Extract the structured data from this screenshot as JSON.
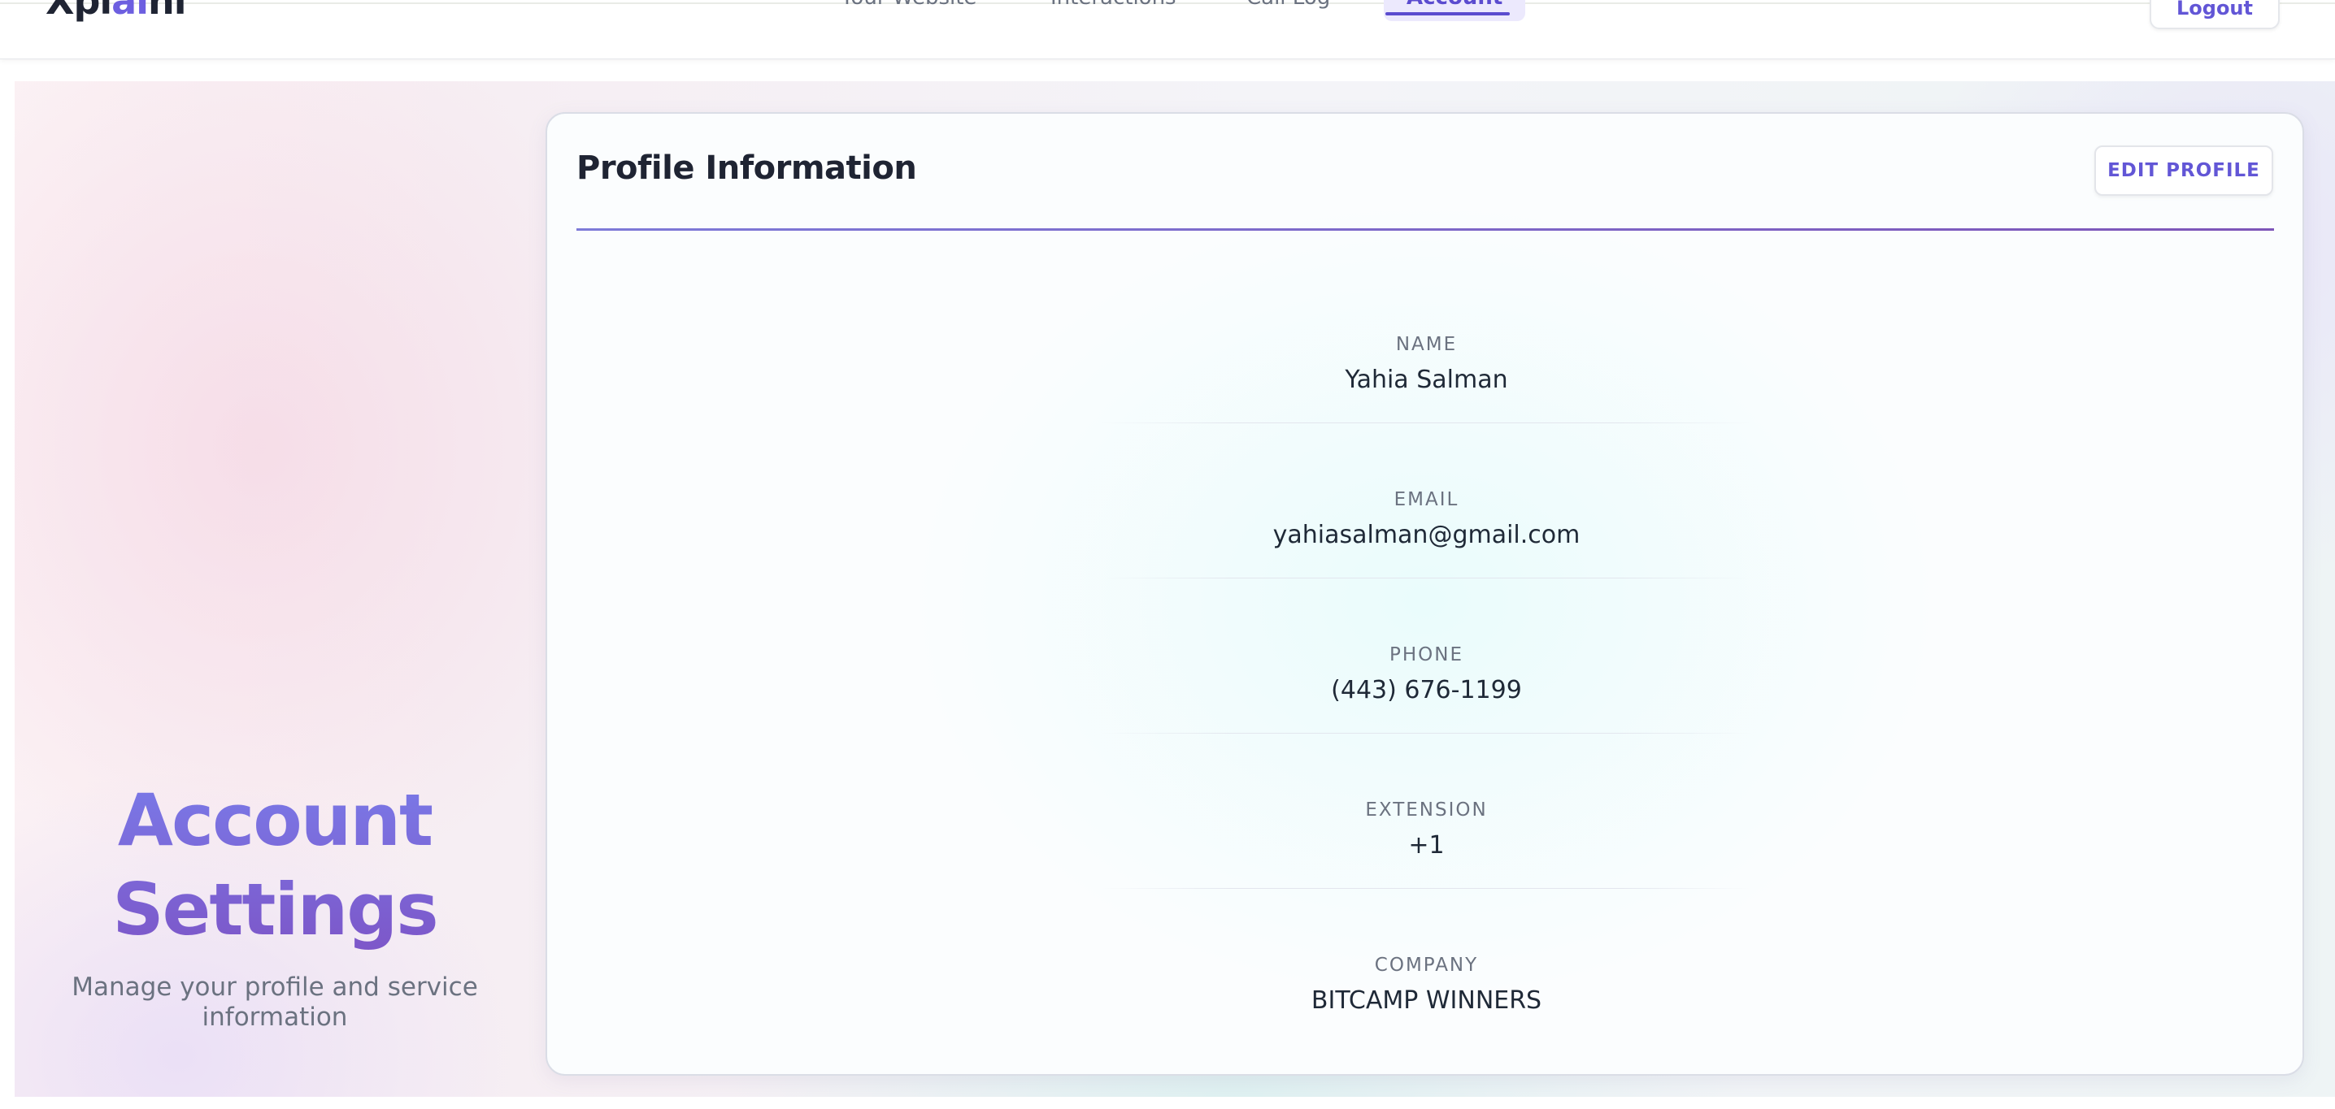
{
  "app": {
    "logo_text_before": "Xpl",
    "logo_text_ai": "ai",
    "logo_text_after": "ni"
  },
  "nav": {
    "items": [
      {
        "label": "Your Website",
        "active": false
      },
      {
        "label": "Interactions",
        "active": false
      },
      {
        "label": "Call Log",
        "active": false
      },
      {
        "label": "Account",
        "active": true
      }
    ],
    "logout_label": "Logout"
  },
  "hero": {
    "title_line1": "Account",
    "title_line2": "Settings",
    "subtitle": "Manage your profile and service information"
  },
  "profile": {
    "title": "Profile Information",
    "edit_label": "EDIT PROFILE",
    "fields": [
      {
        "label": "NAME",
        "value": "Yahia Salman"
      },
      {
        "label": "EMAIL",
        "value": "yahiasalman@gmail.com"
      },
      {
        "label": "PHONE",
        "value": "(443) 676-1199"
      },
      {
        "label": "EXTENSION",
        "value": "+1"
      },
      {
        "label": "COMPANY",
        "value": "BITCAMP WINNERS"
      }
    ]
  },
  "colors": {
    "accent": "#5b4ccf",
    "title_gradient_start": "#7a7ae8",
    "title_gradient_end": "#7d56c8"
  }
}
